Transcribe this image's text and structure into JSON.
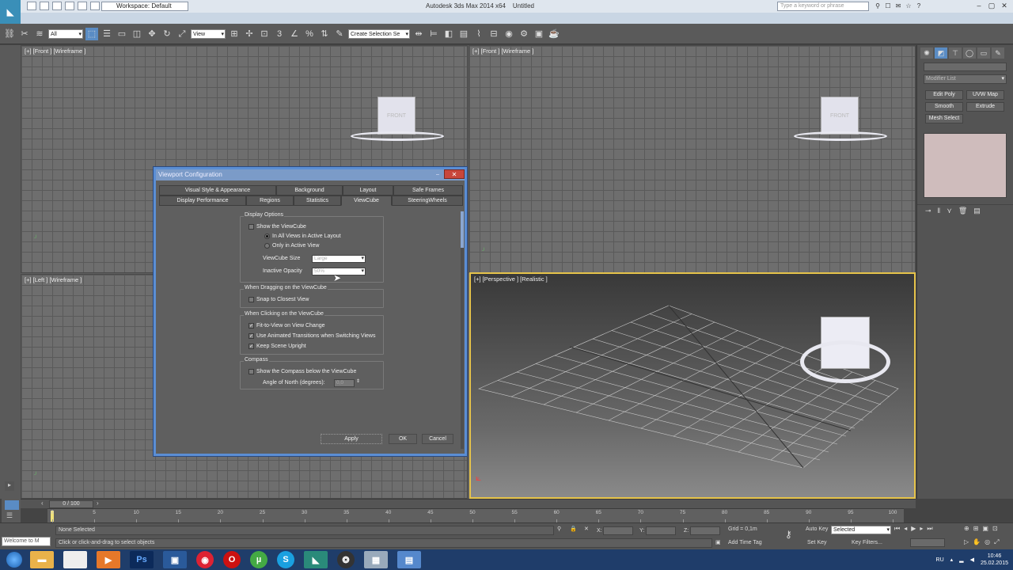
{
  "window": {
    "app_title": "Autodesk 3ds Max 2014 x64",
    "doc_title": "Untitled",
    "workspace": "Workspace: Default",
    "search_placeholder": "Type a keyword or phrase"
  },
  "toolbar": {
    "filter_select": "All",
    "coord_select": "View",
    "named_selection": "Create Selection Se"
  },
  "viewports": {
    "top_left": "[+] [Front ] [Wireframe ]",
    "top_right": "[+] [Front ] [Wireframe ]",
    "bottom_left": "[+] [Left ] [Wireframe ]",
    "bottom_right": "[+] [Perspective ] [Realistic ]",
    "cube_face": "FRONT"
  },
  "command_panel": {
    "modifier_list": "Modifier List",
    "modifiers": [
      "Edit Poly",
      "UVW Map",
      "Smooth",
      "Extrude",
      "Mesh Select"
    ]
  },
  "timeline": {
    "frame_range": "0 / 100",
    "ticks": [
      "0",
      "5",
      "10",
      "15",
      "20",
      "25",
      "30",
      "35",
      "40",
      "45",
      "50",
      "55",
      "60",
      "65",
      "70",
      "75",
      "80",
      "85",
      "90",
      "95",
      "100"
    ]
  },
  "status": {
    "selection": "None Selected",
    "prompt": "Click or click-and-drag to select objects",
    "maxscript": "Welcome to M",
    "x_label": "X:",
    "y_label": "Y:",
    "z_label": "Z:",
    "grid": "Grid = 0,1m",
    "add_time_tag": "Add Time Tag",
    "auto_key": "Auto Key",
    "set_key": "Set Key",
    "key_mode": "Selected",
    "key_filters": "Key Filters..."
  },
  "dialog": {
    "title": "Viewport Configuration",
    "tabs_row1": [
      "Visual Style & Appearance",
      "Background",
      "Layout",
      "Safe Frames"
    ],
    "tabs_row2": [
      "Display Performance",
      "Regions",
      "Statistics",
      "ViewCube",
      "SteeringWheels"
    ],
    "display_options": {
      "title": "Display Options",
      "show_viewcube": "Show the ViewCube",
      "all_views": "In All Views in Active Layout",
      "only_active": "Only in Active View",
      "size_label": "ViewCube Size",
      "size_value": "Large",
      "opacity_label": "Inactive Opacity",
      "opacity_value": "50%"
    },
    "dragging": {
      "title": "When Dragging on the ViewCube",
      "snap": "Snap to Closest View"
    },
    "clicking": {
      "title": "When Clicking on the ViewCube",
      "fit": "Fit-to-View on View Change",
      "animated": "Use Animated Transitions when Switching Views",
      "upright": "Keep Scene Upright"
    },
    "compass": {
      "title": "Compass",
      "show": "Show the Compass below the ViewCube",
      "north_label": "Angle of North (degrees):",
      "north_value": "0,0"
    },
    "buttons": {
      "apply": "Apply",
      "ok": "OK",
      "cancel": "Cancel"
    }
  },
  "taskbar": {
    "language": "RU",
    "time": "10:46",
    "date": "25.02.2015"
  },
  "colors": {
    "dialog_border": "#5b8ed4",
    "active_viewport": "#e6c34a",
    "close_button": "#c8463b"
  }
}
